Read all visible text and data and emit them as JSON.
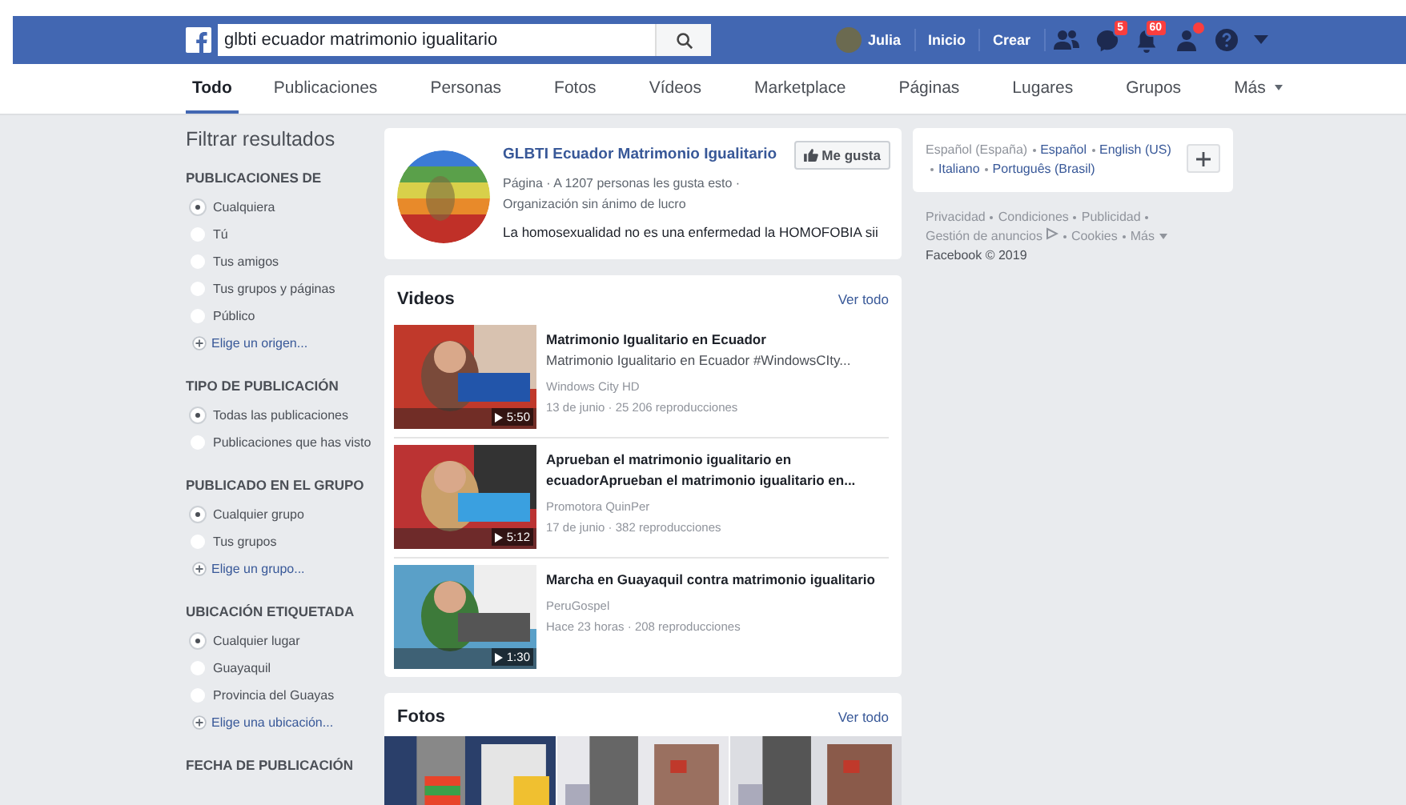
{
  "header": {
    "search_value": "glbti ecuador matrimonio igualitario",
    "user_name": "Julia",
    "links": [
      "Inicio",
      "Crear"
    ],
    "messages_badge": "5",
    "notifications_badge": "60",
    "friend_requests_alert": true
  },
  "tabs": [
    {
      "label": "Todo",
      "selected": true,
      "kind": "tab"
    },
    {
      "label": "Publicaciones",
      "selected": false,
      "kind": "tab"
    },
    {
      "label": "Personas",
      "selected": false,
      "kind": "tab"
    },
    {
      "label": "Fotos",
      "selected": false,
      "kind": "tab"
    },
    {
      "label": "Vídeos",
      "selected": false,
      "kind": "tab"
    },
    {
      "label": "Marketplace",
      "selected": false,
      "kind": "tab"
    },
    {
      "label": "Páginas",
      "selected": false,
      "kind": "tab"
    },
    {
      "label": "Lugares",
      "selected": false,
      "kind": "tab"
    },
    {
      "label": "Grupos",
      "selected": false,
      "kind": "tab"
    },
    {
      "label": "Más",
      "selected": false,
      "kind": "menu"
    }
  ],
  "filters": {
    "title": "Filtrar resultados",
    "sections": [
      {
        "heading": "PUBLICACIONES DE",
        "options": [
          {
            "label": "Cualquiera",
            "selected": true
          },
          {
            "label": "Tú",
            "selected": false
          },
          {
            "label": "Tus amigos",
            "selected": false
          },
          {
            "label": "Tus grupos y páginas",
            "selected": false
          },
          {
            "label": "Público",
            "selected": false
          }
        ],
        "add_link": "Elige un origen..."
      },
      {
        "heading": "TIPO DE PUBLICACIÓN",
        "options": [
          {
            "label": "Todas las publicaciones",
            "selected": true
          },
          {
            "label": "Publicaciones que has visto",
            "selected": false
          }
        ]
      },
      {
        "heading": "PUBLICADO EN EL GRUPO",
        "options": [
          {
            "label": "Cualquier grupo",
            "selected": true
          },
          {
            "label": "Tus grupos",
            "selected": false
          }
        ],
        "add_link": "Elige un grupo..."
      },
      {
        "heading": "UBICACIÓN ETIQUETADA",
        "options": [
          {
            "label": "Cualquier lugar",
            "selected": true
          },
          {
            "label": "Guayaquil",
            "selected": false
          },
          {
            "label": "Provincia del Guayas",
            "selected": false
          }
        ],
        "add_link": "Elige una ubicación..."
      },
      {
        "heading": "FECHA DE PUBLICACIÓN"
      }
    ]
  },
  "page_result": {
    "name": "GLBTI Ecuador Matrimonio Igualitario",
    "meta": "Página · A 1207 personas les gusta esto · Organización sin ánimo de lucro",
    "like_button": "Me gusta",
    "description": "La homosexualidad no es una enfermedad la HOMOFOBIA sii"
  },
  "videos": {
    "title": "Videos",
    "see_all": "Ver todo",
    "items": [
      {
        "title": "Matrimonio Igualitario en Ecuador",
        "description": "Matrimonio Igualitario en Ecuador #WindowsCIty...",
        "channel": "Windows City HD",
        "stats": "13 de junio · 25 206 reproducciones",
        "duration": "5:50"
      },
      {
        "title": "Aprueban el matrimonio igualitario en ecuadorAprueban el matrimonio igualitario en...",
        "channel": "Promotora QuinPer",
        "stats": "17 de junio · 382 reproducciones",
        "duration": "5:12"
      },
      {
        "title": "Marcha en Guayaquil contra matrimonio igualitario",
        "channel": "PeruGospel",
        "stats": "Hace 23 horas · 208 reproducciones",
        "duration": "1:30"
      }
    ]
  },
  "photos": {
    "title": "Fotos",
    "see_all": "Ver todo"
  },
  "languages": [
    {
      "label": "Español (España)",
      "selected": true
    },
    {
      "label": "Español",
      "selected": false
    },
    {
      "label": "English (US)",
      "selected": false
    },
    {
      "label": "Italiano",
      "selected": false
    },
    {
      "label": "Português (Brasil)",
      "selected": false
    }
  ],
  "footer_links": [
    "Privacidad",
    "Condiciones",
    "Publicidad",
    "Gestión de anuncios",
    "Cookies",
    "Más"
  ],
  "copyright": "Facebook © 2019"
}
